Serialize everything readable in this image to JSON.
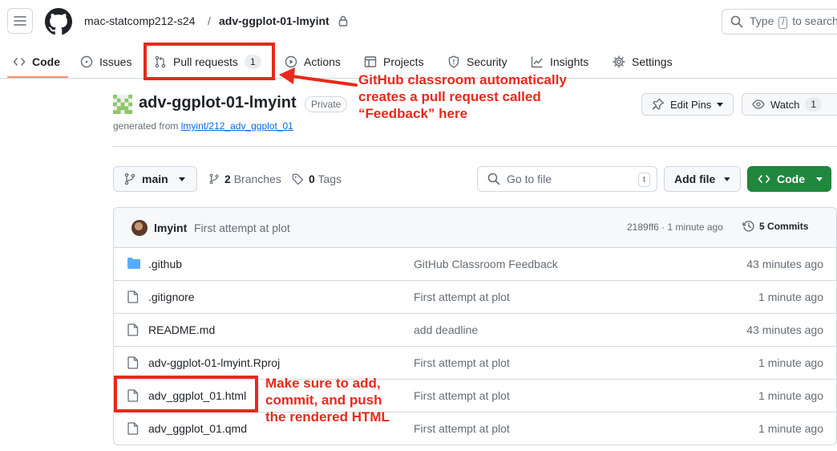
{
  "header": {
    "owner": "mac-statcomp212-s24",
    "separator": "/",
    "repo": "adv-ggplot-01-lmyint",
    "search": {
      "prefix": "Type",
      "key": "/",
      "suffix": "to search"
    }
  },
  "nav": {
    "tabs": [
      {
        "label": "Code",
        "icon": "code-icon",
        "active": true
      },
      {
        "label": "Issues",
        "icon": "issue-icon"
      },
      {
        "label": "Pull requests",
        "icon": "pull-request-icon",
        "count": "1"
      },
      {
        "label": "Actions",
        "icon": "play-icon"
      },
      {
        "label": "Projects",
        "icon": "table-icon"
      },
      {
        "label": "Security",
        "icon": "shield-icon"
      },
      {
        "label": "Insights",
        "icon": "graph-icon"
      },
      {
        "label": "Settings",
        "icon": "gear-icon"
      }
    ]
  },
  "annotations": {
    "pr_note": [
      "GitHub classroom automatically",
      "creates a pull request called",
      "“Feedback” here"
    ],
    "html_note": [
      "Make sure to add,",
      "commit, and push",
      "the rendered HTML"
    ],
    "color": "#e8291c"
  },
  "repo": {
    "title": "adv-ggplot-01-lmyint",
    "visibility": "Private",
    "generated_prefix": "generated from",
    "template_link": "lmyint/212_adv_ggplot_01",
    "edit_pins": "Edit Pins",
    "watch": "Watch",
    "watch_count": "1"
  },
  "branch_bar": {
    "branch": "main",
    "branches_count": "2",
    "branches_label": "Branches",
    "tags_count": "0",
    "tags_label": "Tags",
    "goto_placeholder": "Go to file",
    "goto_key": "t",
    "add_file": "Add file",
    "code": "Code"
  },
  "commit": {
    "author": "lmyint",
    "message": "First attempt at plot",
    "sha_time": "2189ff6 · 1 minute ago",
    "commits_count": "5",
    "commits_label": "Commits"
  },
  "files": [
    {
      "name": ".github",
      "type": "folder",
      "message": "GitHub Classroom Feedback",
      "time": "43 minutes ago"
    },
    {
      "name": ".gitignore",
      "type": "file",
      "message": "First attempt at plot",
      "time": "1 minute ago"
    },
    {
      "name": "README.md",
      "type": "file",
      "message": "add deadline",
      "time": "43 minutes ago"
    },
    {
      "name": "adv-ggplot-01-lmyint.Rproj",
      "type": "file",
      "message": "First attempt at plot",
      "time": "1 minute ago"
    },
    {
      "name": "adv_ggplot_01.html",
      "type": "file",
      "message": "First attempt at plot",
      "time": "1 minute ago"
    },
    {
      "name": "adv_ggplot_01.qmd",
      "type": "file",
      "message": "First attempt at plot",
      "time": "1 minute ago"
    }
  ]
}
